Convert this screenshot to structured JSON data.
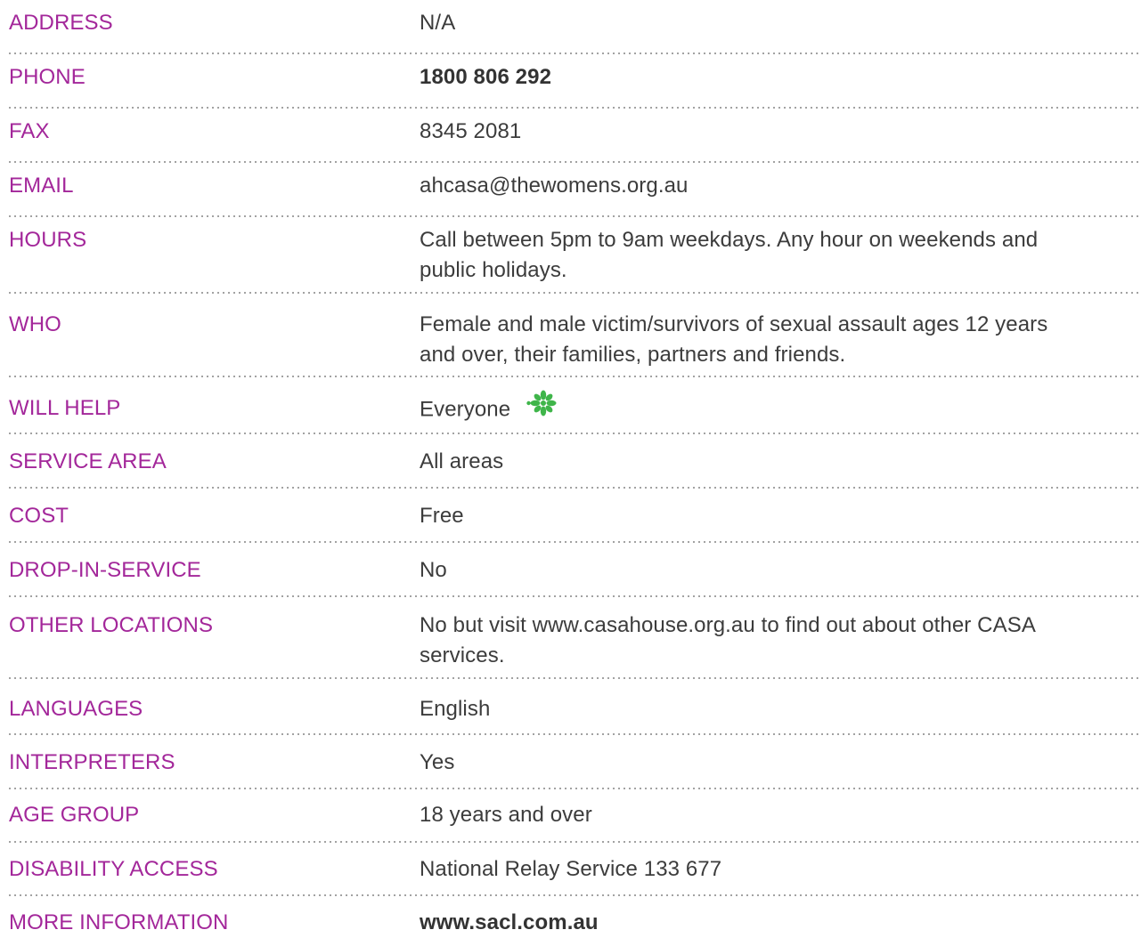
{
  "rows": [
    {
      "label": "ADDRESS",
      "value": "N/A"
    },
    {
      "label": "PHONE",
      "value": "1800 806 292"
    },
    {
      "label": "FAX",
      "value": "8345 2081"
    },
    {
      "label": "EMAIL",
      "value": "ahcasa@thewomens.org.au"
    },
    {
      "label": "HOURS",
      "value_line1": "Call between 5pm to 9am weekdays. Any hour on weekends and",
      "value_line2": "public holidays."
    },
    {
      "label": "WHO",
      "value_line1": "Female and male victim/survivors of sexual assault ages 12 years",
      "value_line2": "and over, their families, partners and friends."
    },
    {
      "label": "WILL HELP",
      "value": "Everyone",
      "icon": "green-flower-icon",
      "icon_color": "#3fb54a"
    },
    {
      "label": "SERVICE AREA",
      "value": "All areas"
    },
    {
      "label": "COST",
      "value": "Free"
    },
    {
      "label": "DROP-IN-SERVICE",
      "value": "No"
    },
    {
      "label": "OTHER LOCATIONS",
      "value_line1": "No but visit www.casahouse.org.au to find out about other CASA",
      "value_line2": "services."
    },
    {
      "label": "LANGUAGES",
      "value": "English"
    },
    {
      "label": "INTERPRETERS",
      "value": "Yes"
    },
    {
      "label": "AGE GROUP",
      "value": "18 years and over"
    },
    {
      "label": "DISABILITY ACCESS",
      "value": "National Relay Service 133 677"
    },
    {
      "label": "MORE INFORMATION",
      "value": "www.sacl.com.au"
    }
  ],
  "colors": {
    "label": "#a3279a",
    "value": "#3c3c3c",
    "divider": "#8a8a8a"
  }
}
